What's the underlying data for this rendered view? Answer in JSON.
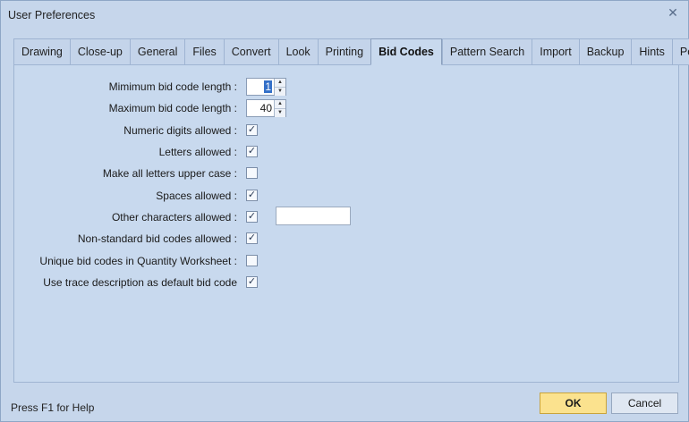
{
  "window": {
    "title": "User Preferences",
    "close_glyph": "✕"
  },
  "tabs": [
    {
      "label": "Drawing"
    },
    {
      "label": "Close-up"
    },
    {
      "label": "General"
    },
    {
      "label": "Files"
    },
    {
      "label": "Convert"
    },
    {
      "label": "Look"
    },
    {
      "label": "Printing"
    },
    {
      "label": "Bid Codes",
      "active": true
    },
    {
      "label": "Pattern Search"
    },
    {
      "label": "Import"
    },
    {
      "label": "Backup"
    },
    {
      "label": "Hints"
    },
    {
      "label": "Points"
    }
  ],
  "settings": {
    "min_length": {
      "label": "Mimimum bid code length :",
      "value": "1"
    },
    "max_length": {
      "label": "Maximum bid code length :",
      "value": "40"
    },
    "numeric": {
      "label": "Numeric digits allowed :",
      "checked": true,
      "mark": "✓"
    },
    "letters": {
      "label": "Letters allowed :",
      "checked": true,
      "mark": "✓"
    },
    "upper": {
      "label": "Make all letters upper case :",
      "checked": false,
      "mark": ""
    },
    "spaces": {
      "label": "Spaces allowed :",
      "checked": true,
      "mark": "✓"
    },
    "other": {
      "label": "Other characters allowed :",
      "checked": true,
      "mark": "✓",
      "text_value": ""
    },
    "nonstandard": {
      "label": "Non-standard bid codes allowed :",
      "checked": true,
      "mark": "✓"
    },
    "unique": {
      "label": "Unique bid codes in Quantity Worksheet :",
      "checked": false,
      "mark": ""
    },
    "trace": {
      "label": "Use trace description as default bid code",
      "checked": true,
      "mark": "✓"
    }
  },
  "footer": {
    "help_text": "Press F1 for Help",
    "ok_label": "OK",
    "cancel_label": "Cancel"
  }
}
